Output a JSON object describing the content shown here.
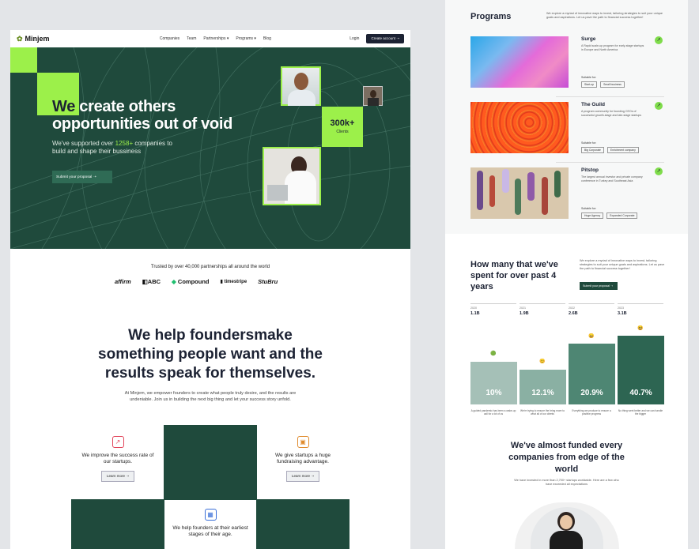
{
  "nav": {
    "logo": "Minjem",
    "links": [
      "Companies",
      "Team",
      "Partnerships ▾",
      "Programs ▾",
      "Blog"
    ],
    "login": "Login",
    "create": "Create account  ➝"
  },
  "hero": {
    "headline_accent": "We",
    "headline_rest": " create others opportunities out of void",
    "sub_pre": "We've supported over ",
    "sub_count": "1258+",
    "sub_post": " companies to build and shape their bussiness",
    "cta": "Submit your proposal      ➝",
    "stat_value": "300k+",
    "stat_label": "Clients"
  },
  "trusted": {
    "text": "Trusted by over 40,000 partnerships all around the world",
    "logos": [
      "affirm",
      "ABC",
      "Compound",
      "timestripe",
      "StuBru"
    ]
  },
  "help": {
    "heading": "We help foundersmake something people want and the results speak for themselves.",
    "para": "At Minjem, we empower founders to create what people truly desire, and the results are undeniable. Join us in building the next big thing and let your success story unfold."
  },
  "features": [
    {
      "text": "We improve the success rate of our startups.",
      "button": "Learn more ➝",
      "icon": "chart-up-icon"
    },
    {
      "text": "We give startups a huge fundraising advantage.",
      "button": "Learn more ➝",
      "icon": "briefcase-icon"
    },
    {
      "text": "We help founders at their earliest stages of their age.",
      "icon": "calendar-icon"
    }
  ],
  "programs": {
    "title": "Programs",
    "desc": "We explore a myriad of innovative ways to invest, tailoring strategies to suit your unique goals and aspirations. Let us pave the path to financial success together!",
    "suitable_label": "Suitable for:",
    "items": [
      {
        "name": "Surge",
        "desc": "A Rapid scale-up program for early-stage startups in Europe and North America",
        "tags": [
          "Start-up",
          "Small business"
        ]
      },
      {
        "name": "The Guild",
        "desc": "A program community for founding CEOs of successful growth-stage and late-stage startups",
        "tags": [
          "Big Corporate",
          "Enrichment company"
        ]
      },
      {
        "name": "Pitstop",
        "desc": "The largest annual investor and private company conference in Turkey and Southeast Asia",
        "tags": [
          "Huge Agency",
          "Expanded Corporate"
        ]
      }
    ]
  },
  "stats": {
    "heading": "How many that we've spent for over past 4 years",
    "desc": "We explore a myriad of innovative ways to invest, tailoring strategies to suit your unique goals and aspirations. Let us pave the path to financial success together!",
    "cta": "Submit your proposal   ➝",
    "years": [
      {
        "year": "2020",
        "value": "1.1B"
      },
      {
        "year": "2021",
        "value": "1.9B"
      },
      {
        "year": "2022",
        "value": "2.6B"
      },
      {
        "year": "2023",
        "value": "3.1B"
      }
    ],
    "bars": [
      {
        "label": "10%",
        "caption": "A guided pandemic has been a wake-up call for a lot of us",
        "emoji": "🟢",
        "color": "#a5c0b7"
      },
      {
        "label": "12.1%",
        "caption": "We're trying to ensure the bring more to what all of our clients",
        "emoji": "😊",
        "color": "#8ab0a3"
      },
      {
        "label": "20.9%",
        "caption": "Everything we produce to ensure a positive progress",
        "emoji": "😄",
        "color": "#4e8673"
      },
      {
        "label": "40.7%",
        "caption": "No thing went better and we can handle the bigger",
        "emoji": "😆",
        "color": "#2d6552"
      }
    ]
  },
  "funded": {
    "heading": "We've almost funded every companies from edge of the world",
    "sub": "We have invested in more than 2,700+ startups worldwide. Here are a few who have exceeded all expectations"
  }
}
